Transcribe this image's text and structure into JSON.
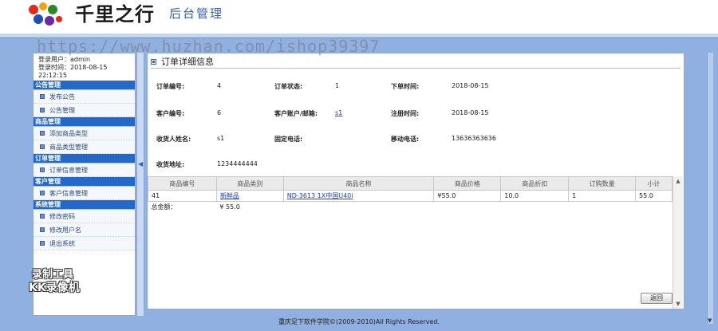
{
  "header": {
    "logo_title": "千里之行",
    "logo_subtitle": "后台管理",
    "watermark": "https://www.huzhan.com/ishop39397"
  },
  "sidebar": {
    "login_user_label": "登录用户：admin",
    "login_time_label": "登录时间：2018-08-15",
    "login_time_extra": "22:12:15",
    "groups": [
      {
        "title": "公告管理",
        "items": [
          "发布公告",
          "公告管理"
        ]
      },
      {
        "title": "商品管理",
        "items": [
          "添加商品类型",
          "商品类型管理"
        ]
      },
      {
        "title": "订单管理",
        "items": [
          "订单信息管理"
        ]
      },
      {
        "title": "客户管理",
        "items": [
          "客户信息管理"
        ]
      },
      {
        "title": "系统管理",
        "items": [
          "修改密码",
          "修改用户名",
          "退出系统"
        ]
      }
    ]
  },
  "recorder_overlay": {
    "line1": "录制工具",
    "line2": "KK录像机"
  },
  "main": {
    "title": "订单详细信息",
    "fields": {
      "order_no_label": "订单编号:",
      "order_no": "4",
      "order_status_label": "订单状态:",
      "order_status": "1",
      "order_time_label": "下单时间:",
      "order_time": "2018-08-15",
      "customer_no_label": "客户编号:",
      "customer_no": "6",
      "customer_account_label": "客户账户/邮箱:",
      "customer_account": "s1",
      "register_time_label": "注册时间:",
      "register_time": "2018-08-15",
      "receiver_label": "收货人姓名:",
      "receiver": "s1",
      "phone_label": "固定电话:",
      "phone": "",
      "mobile_label": "移动电话:",
      "mobile": "13636363636",
      "address_label": "收货地址:",
      "address": "1234444444"
    },
    "table": {
      "headers": [
        "商品编号",
        "商品类别",
        "商品名称",
        "商品价格",
        "商品折扣",
        "订购数量",
        "小计"
      ],
      "rows": [
        {
          "id": "41",
          "category": "新鲜品",
          "name": "ND-3613 1X中国U40i",
          "price": "¥55.0",
          "discount": "10.0",
          "qty": "1",
          "subtotal": "55.0"
        }
      ],
      "total_label": "总金额：",
      "total_value": "¥ 55.0"
    },
    "back_button": "返回"
  },
  "footer": "重庆足下软件学院©(2009-2010)All Rights Reserved."
}
